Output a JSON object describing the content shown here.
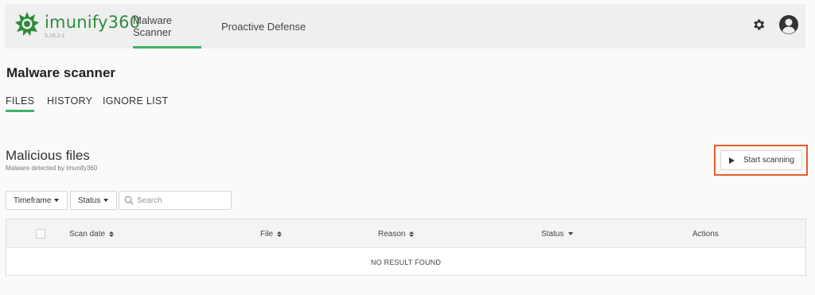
{
  "header": {
    "brand": "imunify360",
    "version": "5.16.2-1",
    "nav": [
      {
        "label": "Malware Scanner",
        "active": true
      },
      {
        "label": "Proactive Defense",
        "active": false
      }
    ],
    "icons": [
      "gear-icon",
      "user-avatar-icon"
    ],
    "accent_color": "#3db367",
    "brand_color": "#2e8b3b"
  },
  "page": {
    "title": "Malware scanner",
    "tabs": [
      {
        "label": "FILES",
        "active": true
      },
      {
        "label": "HISTORY",
        "active": false
      },
      {
        "label": "IGNORE LIST",
        "active": false
      }
    ]
  },
  "section": {
    "title": "Malicious files",
    "subtitle": "Malware detected by Imunify360",
    "start_button": "Start scanning",
    "highlight_color": "#e85d2a"
  },
  "filters": {
    "timeframe": "Timeframe",
    "status": "Status",
    "search_placeholder": "Search"
  },
  "table": {
    "columns": [
      "Scan date",
      "File",
      "Reason",
      "Status",
      "Actions"
    ],
    "empty_message": "NO RESULT FOUND",
    "rows": []
  }
}
